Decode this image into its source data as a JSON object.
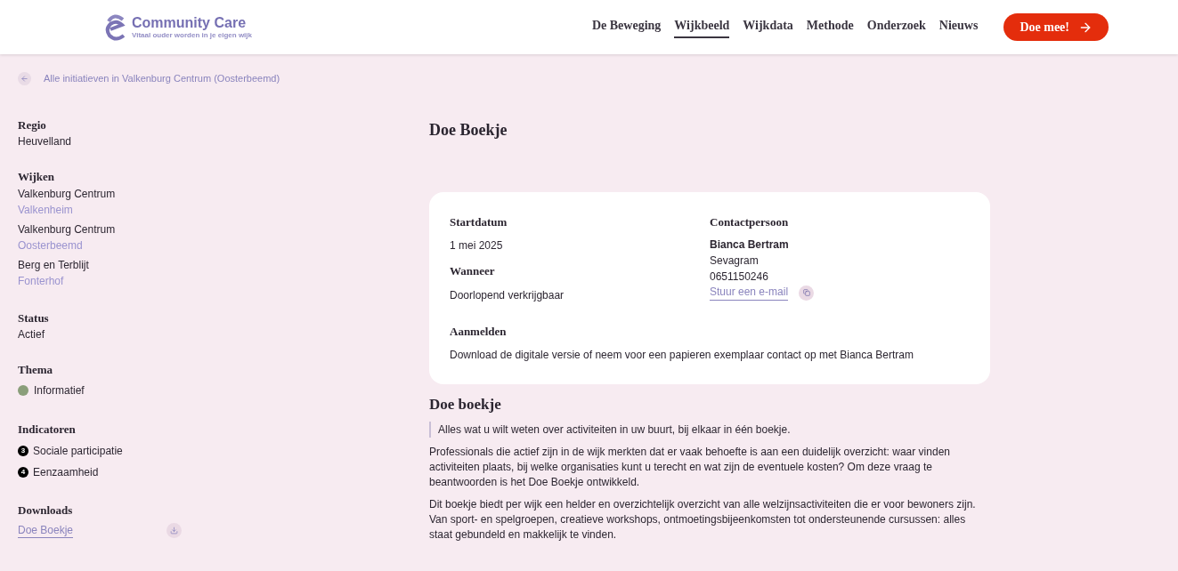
{
  "header": {
    "logo": {
      "name": "Community Care",
      "tagline": "Vitaal ouder worden in je eigen wijk"
    },
    "nav": [
      {
        "label": "De Beweging",
        "selected": false
      },
      {
        "label": "Wijkbeeld",
        "selected": true
      },
      {
        "label": "Wijkdata",
        "selected": false
      },
      {
        "label": "Methode",
        "selected": false
      },
      {
        "label": "Onderzoek",
        "selected": false
      },
      {
        "label": "Nieuws",
        "selected": false
      }
    ],
    "cta": "Doe mee!"
  },
  "back_link": "Alle initiatieven in Valkenburg Centrum (Oosterbeemd)",
  "sidebar": {
    "regio": {
      "heading": "Regio",
      "value": "Heuvelland"
    },
    "wijken": {
      "heading": "Wijken",
      "items": [
        {
          "place": "Valkenburg Centrum",
          "wijk": "Valkenheim"
        },
        {
          "place": "Valkenburg Centrum",
          "wijk": "Oosterbeemd"
        },
        {
          "place": "Berg en Terblijt",
          "wijk": "Fonterhof"
        }
      ]
    },
    "status": {
      "heading": "Status",
      "value": "Actief"
    },
    "thema": {
      "heading": "Thema",
      "items": [
        {
          "label": "Informatief",
          "color": "#8a9e7a"
        }
      ]
    },
    "indicatoren": {
      "heading": "Indicatoren",
      "items": [
        {
          "number": "3",
          "label": "Sociale participatie"
        },
        {
          "number": "4",
          "label": "Eenzaamheid"
        }
      ]
    },
    "downloads": {
      "heading": "Downloads",
      "items": [
        {
          "label": "Doe Boekje"
        }
      ]
    }
  },
  "main": {
    "title": "Doe Boekje",
    "card": {
      "startdatum": {
        "heading": "Startdatum",
        "value": "1 mei 2025"
      },
      "wanneer": {
        "heading": "Wanneer",
        "value": "Doorlopend verkrijgbaar"
      },
      "contact": {
        "heading": "Contactpersoon",
        "name": "Bianca Bertram",
        "organisation": "Sevagram",
        "phone": "0651150246",
        "email_link": "Stuur een e-mail"
      },
      "aanmelden": {
        "heading": "Aanmelden",
        "text": "Download de digitale versie of neem voor een papieren exemplaar contact op met Bianca Bertram"
      }
    },
    "article": {
      "heading": "Doe boekje",
      "quote": "Alles wat u wilt weten over activiteiten in uw buurt, bij elkaar in één boekje.",
      "paragraphs": [
        "Professionals die actief zijn in de wijk merkten dat er vaak behoefte is aan een duidelijk overzicht: waar vinden activiteiten plaats, bij welke organisaties kunt u terecht en wat zijn de eventuele kosten? Om deze vraag te beantwoorden is het Doe Boekje ontwikkeld.",
        "Dit boekje biedt per wijk een helder en overzichtelijk overzicht van alle welzijnsactiviteiten die er voor bewoners zijn. Van sport- en spelgroepen, creatieve workshops, ontmoetingsbijeenkomsten tot ondersteunende cursussen: alles staat gebundeld en makkelijk te vinden."
      ]
    }
  }
}
